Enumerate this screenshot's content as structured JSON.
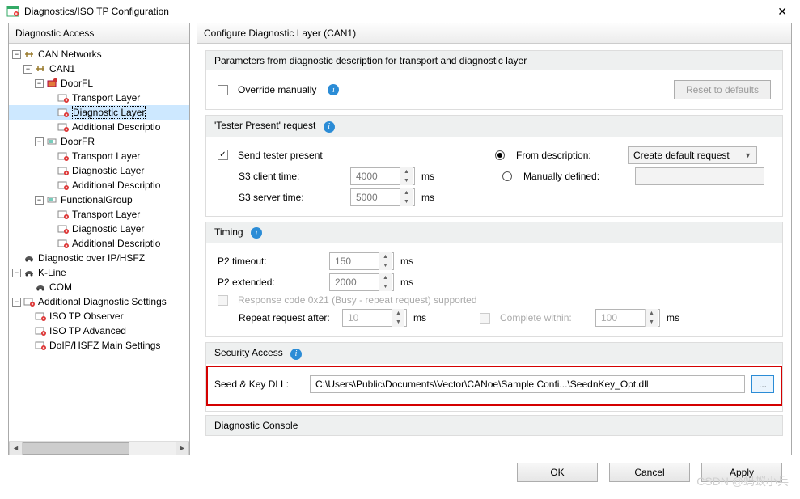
{
  "title": "Diagnostics/ISO TP Configuration",
  "leftPanel": {
    "header": "Diagnostic Access",
    "tree": {
      "r0": "CAN Networks",
      "r1": "CAN1",
      "r2": "DoorFL",
      "r3": "Transport Layer",
      "r4": "Diagnostic Layer",
      "r5": "Additional Descriptio",
      "r6": "DoorFR",
      "r7": "Transport Layer",
      "r8": "Diagnostic Layer",
      "r9": "Additional Descriptio",
      "r10": "FunctionalGroup",
      "r11": "Transport Layer",
      "r12": "Diagnostic Layer",
      "r13": "Additional Descriptio",
      "r14": "Diagnostic over IP/HSFZ",
      "r15": "K-Line",
      "r16": "COM",
      "r17": "Additional Diagnostic Settings",
      "r18": "ISO TP Observer",
      "r19": "ISO TP Advanced",
      "r20": "DoIP/HSFZ Main Settings"
    }
  },
  "rightPanel": {
    "header": "Configure Diagnostic Layer (CAN1)",
    "paramsHeader": "Parameters from diagnostic description for transport and diagnostic layer",
    "overrideLabel": "Override manually",
    "resetBtn": "Reset to defaults",
    "tpHeader": "'Tester Present' request",
    "sendTester": "Send tester present",
    "fromDesc": "From description:",
    "manualDef": "Manually defined:",
    "createDefault": "Create default request",
    "s3client": "S3 client time:",
    "s3clientVal": "4000",
    "s3server": "S3 server time:",
    "s3serverVal": "5000",
    "ms": "ms",
    "timingHeader": "Timing",
    "p2timeout": "P2 timeout:",
    "p2timeoutVal": "150",
    "p2ext": "P2 extended:",
    "p2extVal": "2000",
    "respCode": "Response code 0x21 (Busy - repeat request) supported",
    "repeatAfter": "Repeat request after:",
    "repeatAfterVal": "10",
    "completeWithin": "Complete within:",
    "completeWithinVal": "100",
    "secHeader": "Security Access",
    "seedKeyLbl": "Seed & Key DLL:",
    "seedKeyVal": "C:\\Users\\Public\\Documents\\Vector\\CANoe\\Sample Confi...\\SeednKey_Opt.dll",
    "browseBtn": "...",
    "diagConsole": "Diagnostic Console"
  },
  "buttons": {
    "ok": "OK",
    "cancel": "Cancel",
    "apply": "Apply"
  },
  "watermark": "CSDN @蚂蚁小兵"
}
